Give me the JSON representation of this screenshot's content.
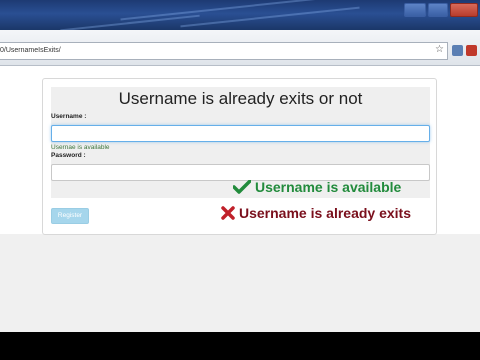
{
  "browser": {
    "address_url": "0/UsernameIsExits/",
    "star_icon": "star-icon",
    "extension_icons": [
      "extension-icon",
      "adblock-icon"
    ]
  },
  "page": {
    "title": "Username is already exits or not",
    "username_label": "Username :",
    "username_value": "",
    "username_help": "Usernae is available",
    "password_label": "Password :",
    "password_value": "",
    "register_label": "Register"
  },
  "annotations": {
    "available_icon": "check-icon",
    "available_text": "Username is available",
    "available_color": "#228b3c",
    "exists_icon": "cross-icon",
    "exists_text": "Username is already exits",
    "exists_color": "#7a0f1c"
  }
}
